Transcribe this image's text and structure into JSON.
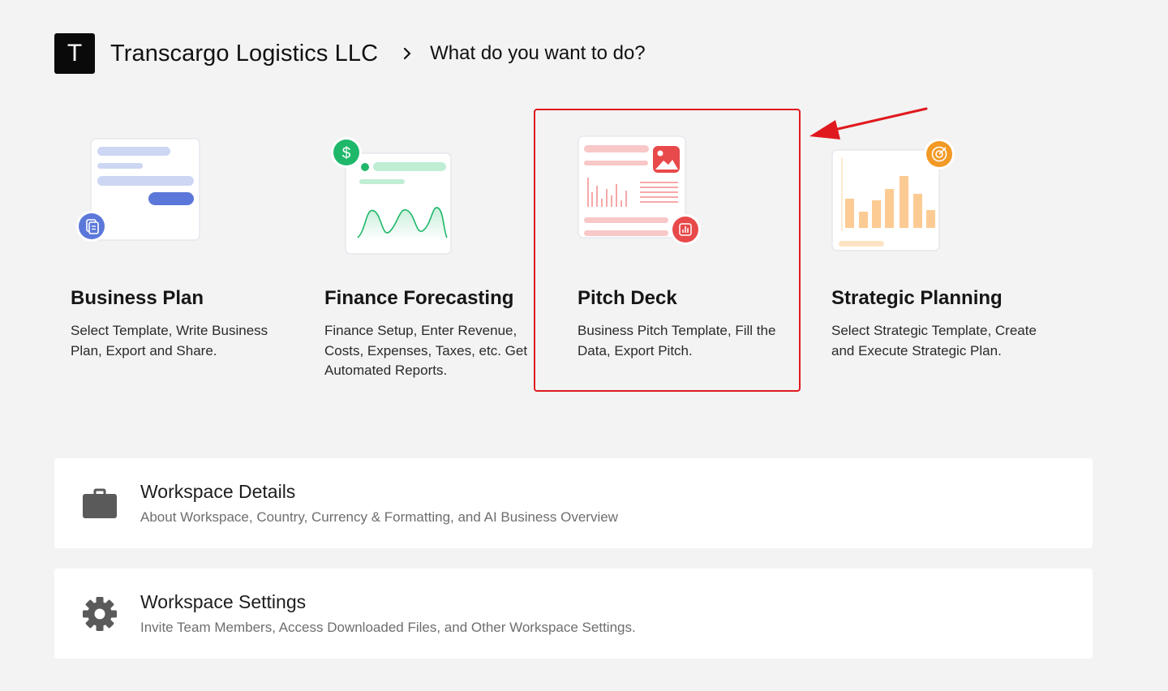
{
  "header": {
    "avatar_letter": "T",
    "company": "Transcargo Logistics LLC",
    "question": "What do you want to do?"
  },
  "cards": [
    {
      "title": "Business Plan",
      "description": "Select Template, Write Business Plan, Export and Share.",
      "icon": "document-icon"
    },
    {
      "title": "Finance Forecasting",
      "description": "Finance Setup, Enter Revenue, Costs, Expenses, Taxes, etc. Get Automated Reports.",
      "icon": "dollar-icon"
    },
    {
      "title": "Pitch Deck",
      "description": "Business Pitch Template, Fill the Data, Export Pitch.",
      "icon": "chart-icon"
    },
    {
      "title": "Strategic Planning",
      "description": "Select Strategic Template, Create and Execute Strategic Plan.",
      "icon": "target-icon"
    }
  ],
  "rows": [
    {
      "title": "Workspace Details",
      "description": "About Workspace, Country, Currency & Formatting, and AI Business Overview",
      "icon": "briefcase-icon"
    },
    {
      "title": "Workspace Settings",
      "description": "Invite Team Members, Access Downloaded Files, and Other Workspace Settings.",
      "icon": "gear-icon"
    }
  ],
  "colors": {
    "highlight": "#e0191e",
    "business_plan": "#5b77d9",
    "finance": "#1fb86a",
    "pitch": "#e8494a",
    "strategic": "#f29a26"
  }
}
